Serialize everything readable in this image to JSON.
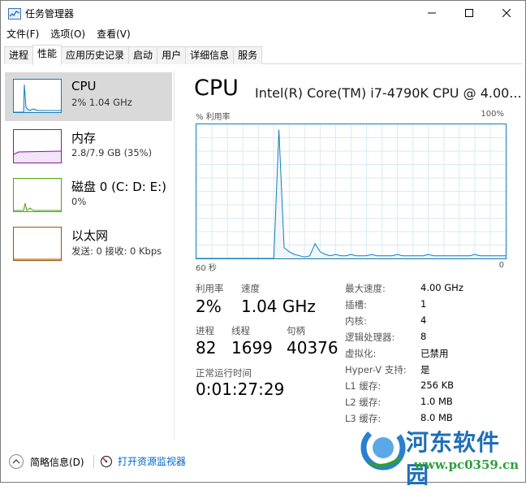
{
  "window": {
    "title": "任务管理器"
  },
  "menu": [
    "文件(F)",
    "选项(O)",
    "查看(V)"
  ],
  "tabs": [
    "进程",
    "性能",
    "应用历史记录",
    "启动",
    "用户",
    "详细信息",
    "服务"
  ],
  "resources": [
    {
      "name": "CPU",
      "detail": "2% 1.04 GHz",
      "color": "#117dbb"
    },
    {
      "name": "内存",
      "detail": "2.8/7.9 GB (35%)",
      "color": "#8b12ae"
    },
    {
      "name": "磁盘 0 (C: D: E:)",
      "detail": "0%",
      "color": "#4da60c"
    },
    {
      "name": "以太网",
      "detail": "发送: 0 接收: 0 Kbps",
      "color": "#a74f01"
    }
  ],
  "cpu": {
    "title": "CPU",
    "model": "Intel(R) Core(TM) i7-4790K CPU @ 4.00...",
    "graph_label_left": "% 利用率",
    "graph_label_right": "100%",
    "axis_left": "60 秒",
    "axis_right": "0",
    "utilization_label": "利用率",
    "utilization_value": "2%",
    "speed_label": "速度",
    "speed_value": "1.04 GHz",
    "processes_label": "进程",
    "processes_value": "82",
    "threads_label": "线程",
    "threads_value": "1699",
    "handles_label": "句柄",
    "handles_value": "40376",
    "uptime_label": "正常运行时间",
    "uptime_value": "0:01:27:29",
    "specs": [
      {
        "label": "最大速度:",
        "value": "4.00 GHz"
      },
      {
        "label": "插槽:",
        "value": "1"
      },
      {
        "label": "内核:",
        "value": "4"
      },
      {
        "label": "逻辑处理器:",
        "value": "8"
      },
      {
        "label": "虚拟化:",
        "value": "已禁用"
      },
      {
        "label": "Hyper-V 支持:",
        "value": "是"
      },
      {
        "label": "L1 缓存:",
        "value": "256 KB"
      },
      {
        "label": "L2 缓存:",
        "value": "1.0 MB"
      },
      {
        "label": "L3 缓存:",
        "value": "8.0 MB"
      }
    ],
    "usage_history": [
      0,
      0,
      0,
      0,
      0,
      0,
      0,
      0,
      0,
      0,
      0,
      0,
      0,
      0,
      0,
      0,
      96,
      8,
      5,
      3,
      2,
      1,
      2,
      11,
      5,
      3,
      2,
      3,
      2,
      2,
      3,
      2,
      2,
      2,
      3,
      2,
      2,
      2,
      2,
      3,
      2,
      2,
      2,
      2,
      2,
      3,
      2,
      2,
      2,
      2,
      2,
      2,
      2,
      2,
      3,
      2,
      2,
      2,
      2,
      2,
      2
    ]
  },
  "footer": {
    "fewer_details": "简略信息(D)",
    "open_monitor": "打开资源监视器"
  },
  "watermark": {
    "text": "河东软件园",
    "url": "www.pc0359.cn"
  }
}
